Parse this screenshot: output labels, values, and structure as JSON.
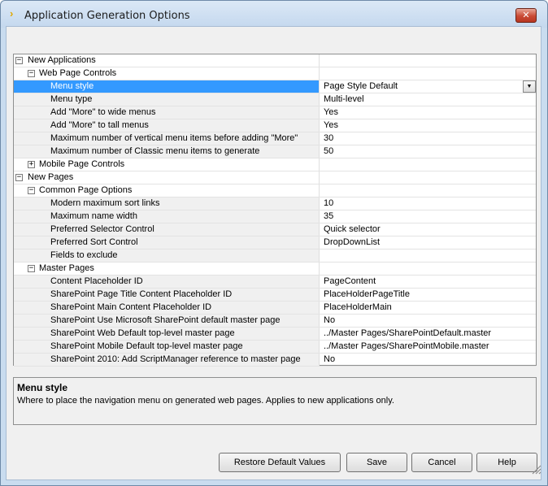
{
  "window": {
    "title": "Application Generation Options",
    "close_label": "✕"
  },
  "grid": {
    "rows": [
      {
        "level": 0,
        "toggle": "−",
        "label": "New Applications",
        "value": ""
      },
      {
        "level": 1,
        "toggle": "−",
        "label": "Web Page Controls",
        "value": ""
      },
      {
        "level": 2,
        "label": "Menu style",
        "value": "Page Style Default",
        "selected": true,
        "dropdown": true
      },
      {
        "level": 2,
        "label": "Menu type",
        "value": "Multi-level"
      },
      {
        "level": 2,
        "label": "Add \"More\" to wide menus",
        "value": "Yes"
      },
      {
        "level": 2,
        "label": "Add \"More\" to tall menus",
        "value": "Yes"
      },
      {
        "level": 2,
        "label": "Maximum number of vertical menu items before adding \"More\"",
        "value": "30"
      },
      {
        "level": 2,
        "label": "Maximum number of Classic menu items to generate",
        "value": "50"
      },
      {
        "level": 1,
        "toggle": "+",
        "label": "Mobile Page Controls",
        "value": ""
      },
      {
        "level": 0,
        "toggle": "−",
        "label": "New Pages",
        "value": ""
      },
      {
        "level": 1,
        "toggle": "−",
        "label": "Common Page Options",
        "value": ""
      },
      {
        "level": 2,
        "label": "Modern maximum sort links",
        "value": "10"
      },
      {
        "level": 2,
        "label": "Maximum name width",
        "value": "35"
      },
      {
        "level": 2,
        "label": "Preferred Selector Control",
        "value": "Quick selector"
      },
      {
        "level": 2,
        "label": "Preferred Sort Control",
        "value": "DropDownList"
      },
      {
        "level": 2,
        "label": "Fields to exclude",
        "value": ""
      },
      {
        "level": 1,
        "toggle": "−",
        "label": "Master Pages",
        "value": ""
      },
      {
        "level": 2,
        "label": "Content Placeholder ID",
        "value": "PageContent"
      },
      {
        "level": 2,
        "label": "SharePoint Page Title Content Placeholder ID",
        "value": "PlaceHolderPageTitle"
      },
      {
        "level": 2,
        "label": "SharePoint Main Content Placeholder ID",
        "value": "PlaceHolderMain"
      },
      {
        "level": 2,
        "label": "SharePoint Use Microsoft SharePoint default master page",
        "value": "No"
      },
      {
        "level": 2,
        "label": "SharePoint Web Default top-level master page",
        "value": "../Master Pages/SharePointDefault.master"
      },
      {
        "level": 2,
        "label": "SharePoint Mobile Default top-level master page",
        "value": "../Master Pages/SharePointMobile.master"
      },
      {
        "level": 2,
        "label": "SharePoint 2010: Add ScriptManager reference to master page",
        "value": "No"
      }
    ]
  },
  "description": {
    "title": "Menu style",
    "text": "Where to place the navigation menu on generated web pages. Applies to new applications only."
  },
  "buttons": {
    "restore": "Restore Default Values",
    "save": "Save",
    "cancel": "Cancel",
    "help": "Help"
  },
  "colors": {
    "selection": "#3399ff",
    "client_bg": "#f0f0f0",
    "frame": "#c9dcef"
  }
}
